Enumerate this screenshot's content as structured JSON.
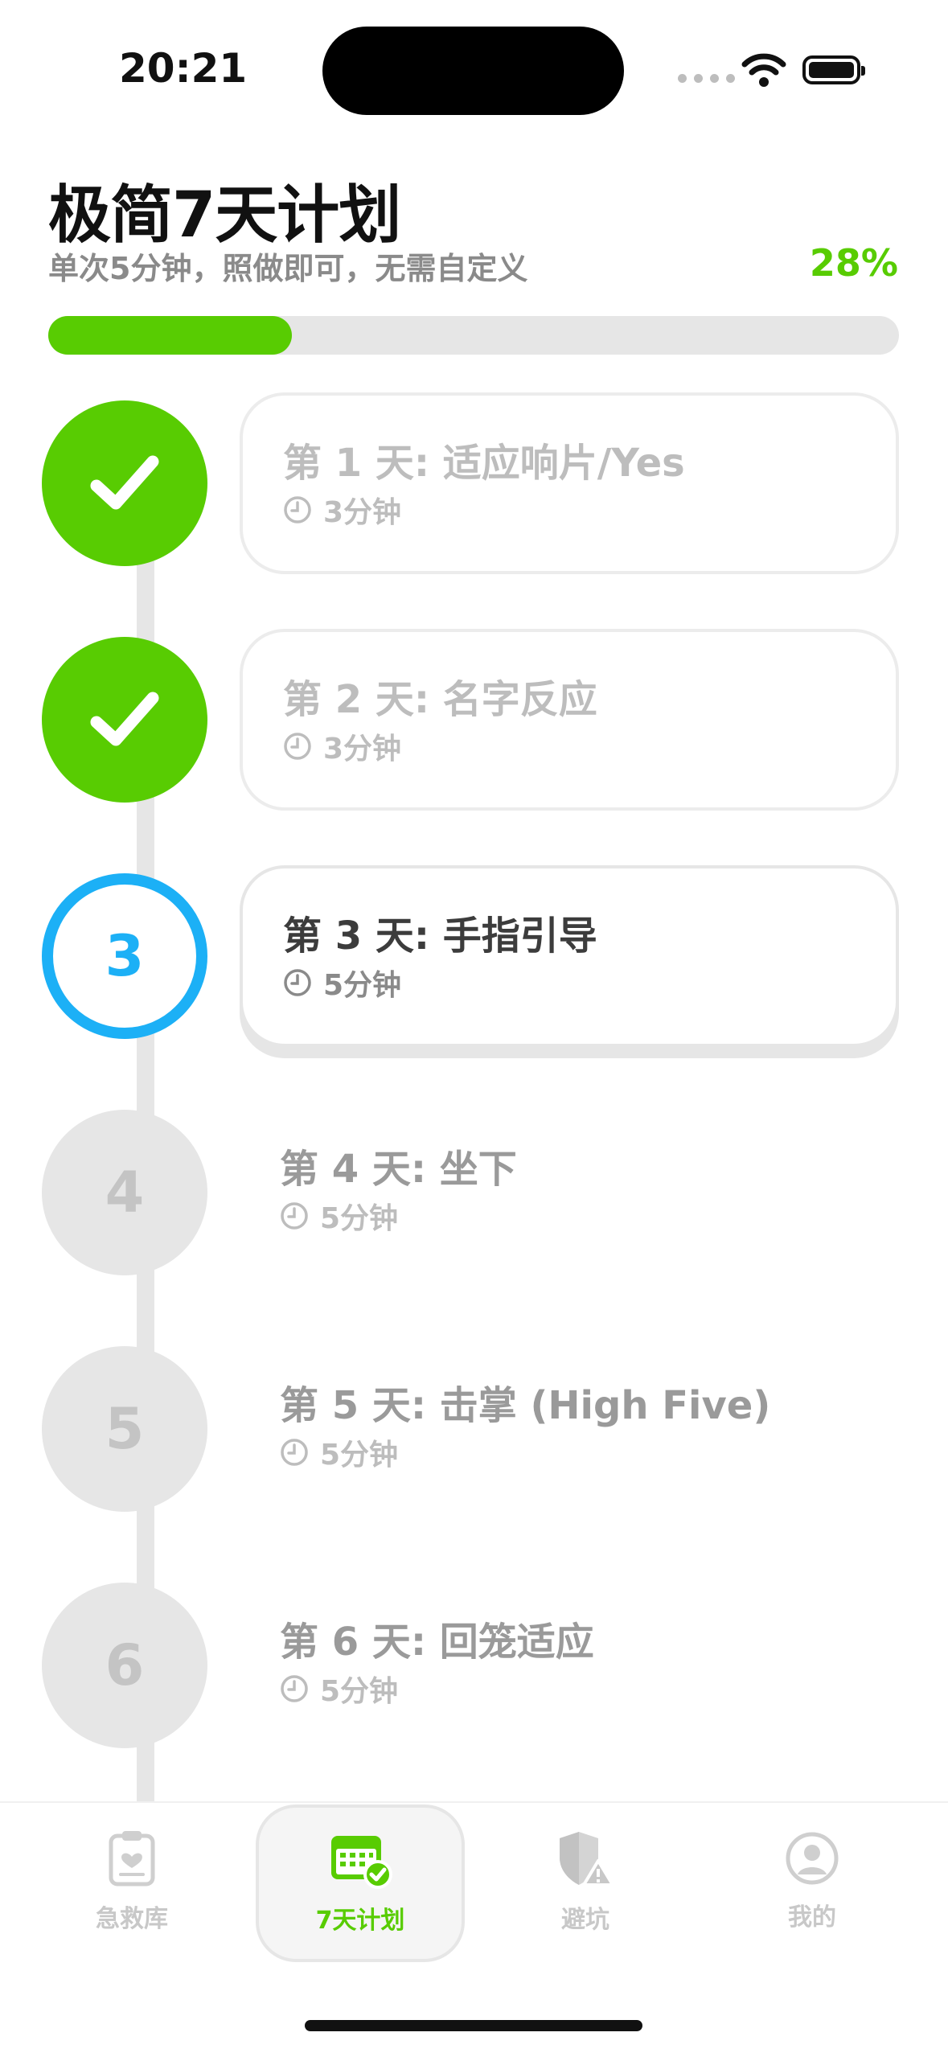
{
  "status": {
    "time": "20:21"
  },
  "header": {
    "title": "极简7天计划",
    "subtitle": "单次5分钟，照做即可，无需自定义",
    "percent_label": "28%",
    "progress": 0.286
  },
  "colors": {
    "accent": "#58cc02",
    "current": "#1cb0f6",
    "locked": "#e6e6e6"
  },
  "steps": [
    {
      "node": "",
      "state": "done",
      "title": "第 1 天: 适应响片/Yes",
      "duration": "3分钟"
    },
    {
      "node": "",
      "state": "done",
      "title": "第 2 天: 名字反应",
      "duration": "3分钟"
    },
    {
      "node": "3",
      "state": "current",
      "title": "第 3 天: 手指引导",
      "duration": "5分钟"
    },
    {
      "node": "4",
      "state": "locked",
      "title": "第 4 天: 坐下",
      "duration": "5分钟"
    },
    {
      "node": "5",
      "state": "locked",
      "title": "第 5 天: 击掌 (High Five)",
      "duration": "5分钟"
    },
    {
      "node": "6",
      "state": "locked",
      "title": "第 6 天: 回笼适应",
      "duration": "5分钟"
    }
  ],
  "tabs": [
    {
      "label": "急救库",
      "icon": "clipboard-heart-icon",
      "active": false
    },
    {
      "label": "7天计划",
      "icon": "calendar-check-icon",
      "active": true
    },
    {
      "label": "避坑",
      "icon": "shield-warning-icon",
      "active": false
    },
    {
      "label": "我的",
      "icon": "person-circle-icon",
      "active": false
    }
  ]
}
